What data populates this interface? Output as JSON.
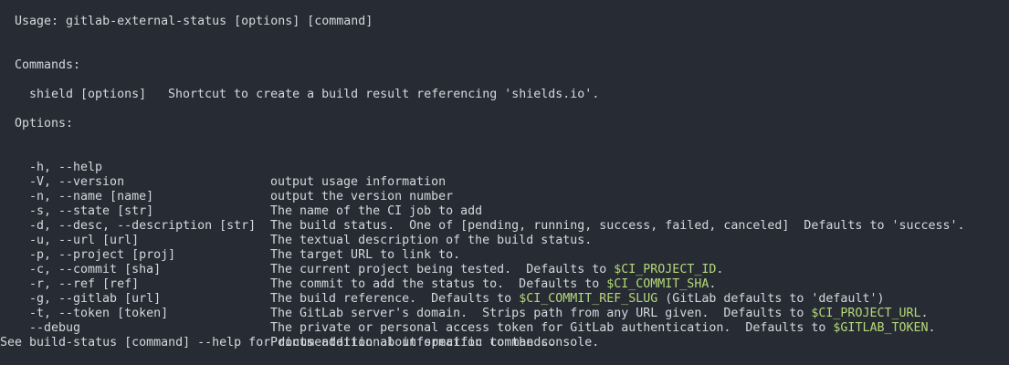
{
  "usage_line": "Usage: gitlab-external-status [options] [command]",
  "commands_header": "Commands:",
  "commands": [
    {
      "name": "shield [options]",
      "description": "Shortcut to create a build result referencing 'shields.io'."
    }
  ],
  "options_header": "Options:",
  "options": [
    {
      "flag": "-h, --help",
      "desc": "output usage information"
    },
    {
      "flag": "-V, --version",
      "desc": "output the version number"
    },
    {
      "flag": "-n, --name [name]",
      "desc": "The name of the CI job to add"
    },
    {
      "flag": "-s, --state [str]",
      "desc": "The build status.  One of [pending, running, success, failed, canceled]  Defaults to 'success'."
    },
    {
      "flag": "-d, --desc, --description [str]",
      "desc": "The textual description of the build status."
    },
    {
      "flag": "-u, --url [url]",
      "desc": "The target URL to link to."
    },
    {
      "flag": "-p, --project [proj]",
      "desc_pre": "The current project being tested.  Defaults to ",
      "env": "$CI_PROJECT_ID",
      "desc_post": "."
    },
    {
      "flag": "-c, --commit [sha]",
      "desc_pre": "The commit to add the status to.  Defaults to ",
      "env": "$CI_COMMIT_SHA",
      "desc_post": "."
    },
    {
      "flag": "-r, --ref [ref]",
      "desc_pre": "The build reference.  Defaults to ",
      "env": "$CI_COMMIT_REF_SLUG",
      "desc_post": " (GitLab defaults to 'default')"
    },
    {
      "flag": "-g, --gitlab [url]",
      "desc_pre": "The GitLab server's domain.  Strips path from any URL given.  Defaults to ",
      "env": "$CI_PROJECT_URL",
      "desc_post": "."
    },
    {
      "flag": "-t, --token [token]",
      "desc_pre": "The private or personal access token for GitLab authentication.  Defaults to ",
      "env": "$GITLAB_TOKEN",
      "desc_post": "."
    },
    {
      "flag": "--debug",
      "desc": "Prints additional information to the console."
    }
  ],
  "footer_line": "See build-status [command] --help for documentation about specific commands.",
  "colors": {
    "background": "#272b33",
    "text": "#d4d8de",
    "env_highlight": "#b5d87a"
  }
}
